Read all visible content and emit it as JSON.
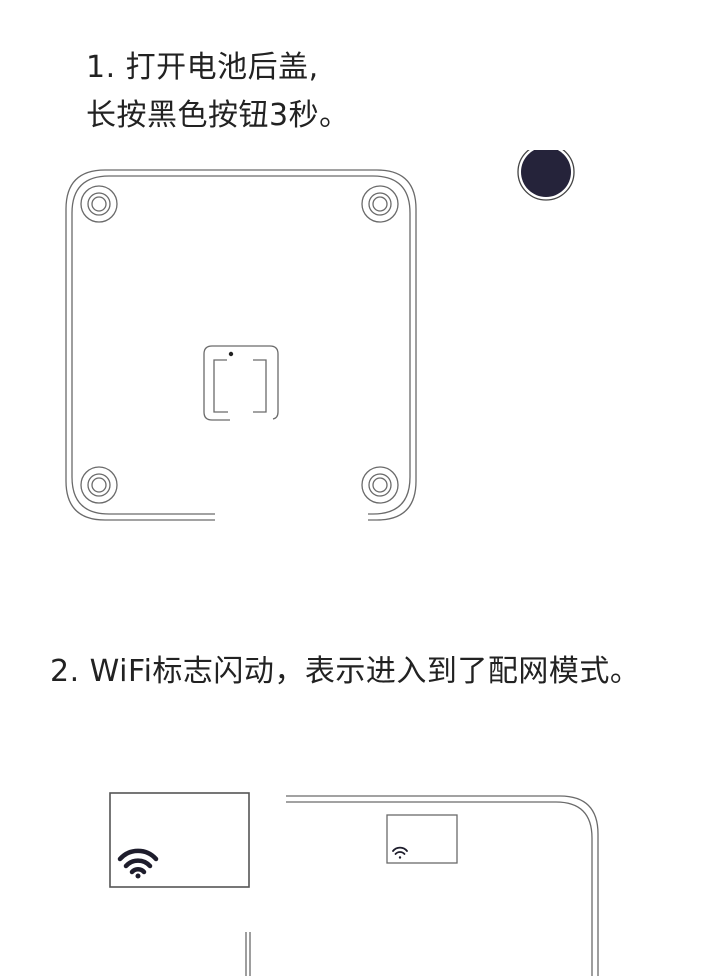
{
  "step1": {
    "line1": "1. 打开电池后盖,",
    "line2": "长按黑色按钮3秒。"
  },
  "step2": {
    "text": "2. WiFi标志闪动，表示进入到了配网模式。"
  },
  "icons": {
    "reset_button": "black-round-button-icon",
    "wifi": "wifi-icon",
    "screw": "screw-hole-icon"
  },
  "colors": {
    "button_fill": "#25233a",
    "line": "#6a6a6a",
    "text": "#222222"
  }
}
